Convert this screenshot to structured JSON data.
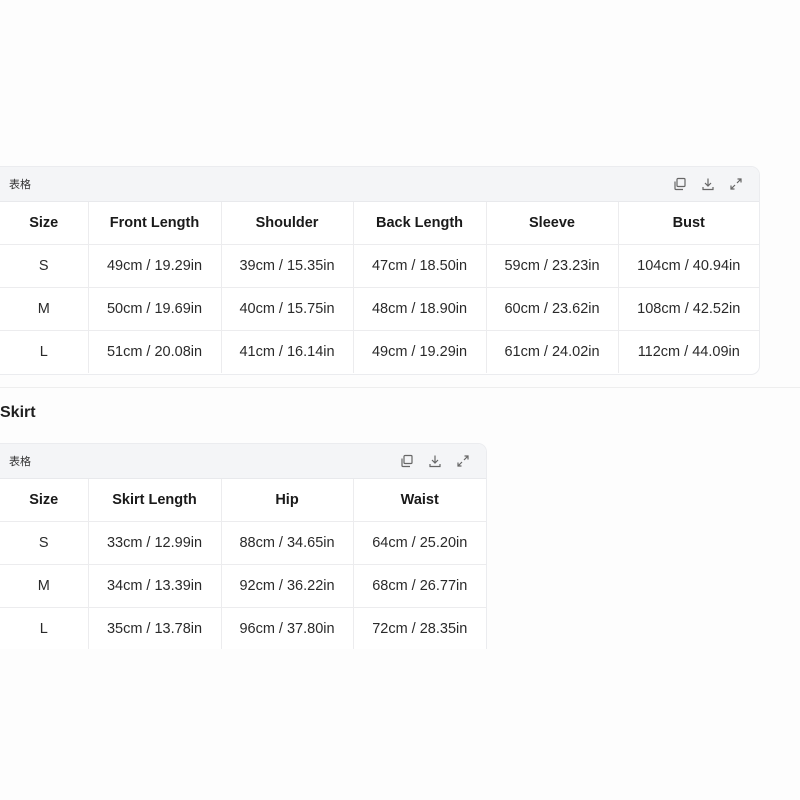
{
  "top_table": {
    "header_label": "表格",
    "columns": [
      "Size",
      "Front Length",
      "Shoulder",
      "Back Length",
      "Sleeve",
      "Bust"
    ],
    "rows": [
      [
        "S",
        "49cm / 19.29in",
        "39cm / 15.35in",
        "47cm / 18.50in",
        "59cm / 23.23in",
        "104cm / 40.94in"
      ],
      [
        "M",
        "50cm / 19.69in",
        "40cm / 15.75in",
        "48cm / 18.90in",
        "60cm / 23.62in",
        "108cm / 42.52in"
      ],
      [
        "L",
        "51cm / 20.08in",
        "41cm / 16.14in",
        "49cm / 19.29in",
        "61cm / 24.02in",
        "112cm / 44.09in"
      ]
    ]
  },
  "skirt_section": {
    "title": "Skirt",
    "header_label": "表格",
    "columns": [
      "Size",
      "Skirt Length",
      "Hip",
      "Waist"
    ],
    "rows": [
      [
        "S",
        "33cm / 12.99in",
        "88cm / 34.65in",
        "64cm / 25.20in"
      ],
      [
        "M",
        "34cm / 13.39in",
        "92cm / 36.22in",
        "68cm / 26.77in"
      ],
      [
        "L",
        "35cm / 13.78in",
        "96cm / 37.80in",
        "72cm / 28.35in"
      ]
    ]
  },
  "icons": {
    "copy": "copy-icon",
    "download": "download-icon",
    "expand": "expand-icon"
  }
}
